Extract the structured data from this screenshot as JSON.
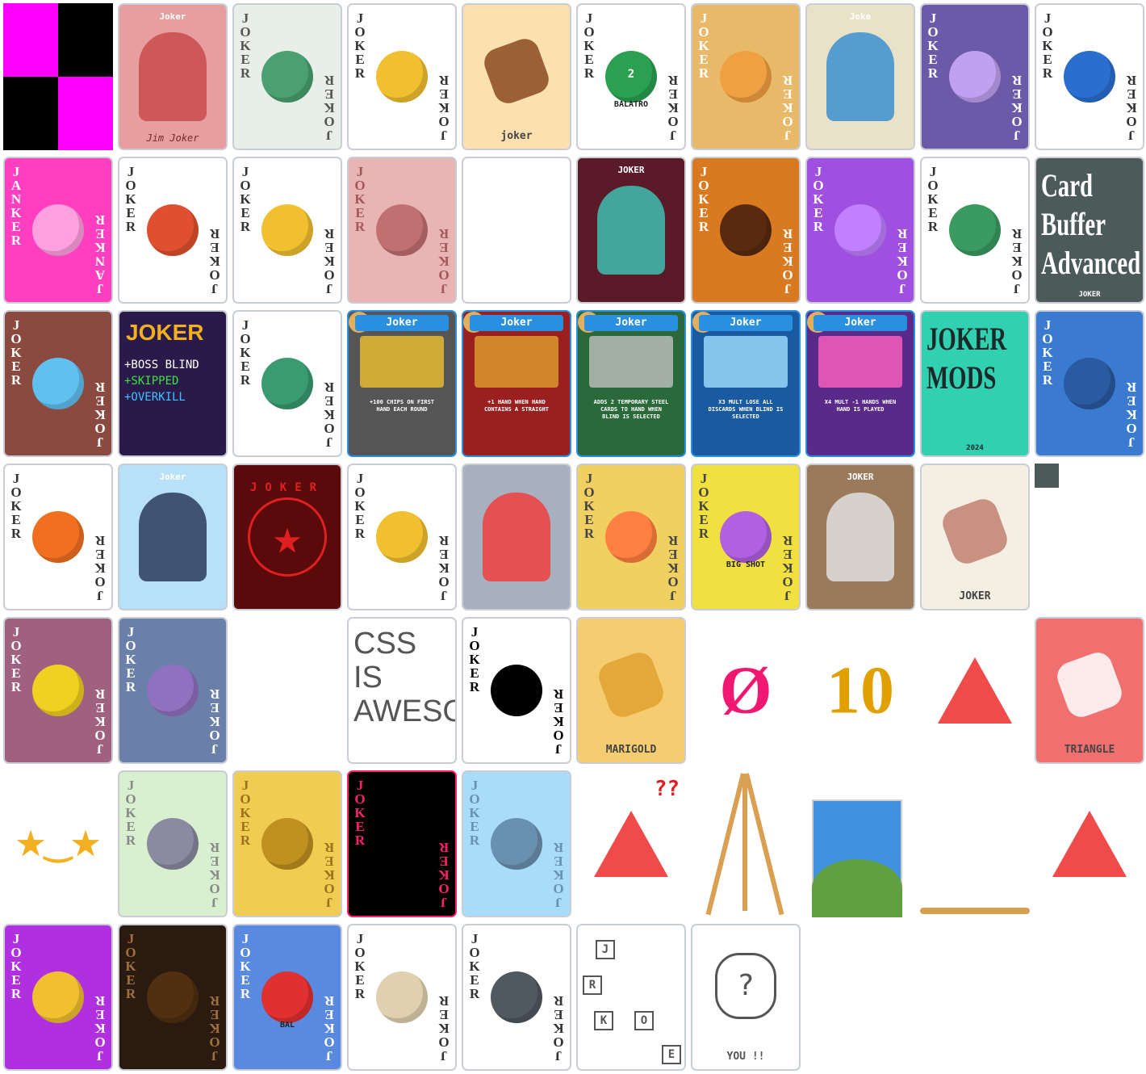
{
  "title": "",
  "tiles": [
    {
      "name": "missing-texture",
      "kind": "checker",
      "bg": "#ff00ff",
      "fg": "#000000"
    },
    {
      "name": "baseball-joker",
      "kind": "photo",
      "bg": "#e79e9e",
      "art_color": "#c94a4a",
      "caption": "Joker",
      "signature": "Jim Joker"
    },
    {
      "name": "bookshelf-joker",
      "kind": "corner",
      "corner": "JOKER",
      "bg": "#e8eee8",
      "corner_color": "#555",
      "art_color": "#4aa070"
    },
    {
      "name": "classic-joker",
      "kind": "corner",
      "corner": "JOKER",
      "bg": "#ffffff",
      "corner_color": "#333",
      "art_color": "#f0c030"
    },
    {
      "name": "pipe-joker",
      "kind": "label",
      "bg": "#fde0b0",
      "art_color": "#8a4a20",
      "label": "joker"
    },
    {
      "name": "balatro-box-joker",
      "kind": "corner",
      "corner": "JOKER",
      "bg": "#ffffff",
      "corner_color": "#333",
      "art_color": "#2aa050",
      "badge": "BALATRO",
      "num": "2"
    },
    {
      "name": "icecream-joker",
      "kind": "corner",
      "corner": "JOKER",
      "bg": "#e9b96a",
      "corner_color": "#fff",
      "art_color": "#f0a040"
    },
    {
      "name": "globe-joker",
      "kind": "photo",
      "bg": "#e9e2c8",
      "art_color": "#3b8fd0",
      "caption": "Joke"
    },
    {
      "name": "lightning-joker",
      "kind": "corner",
      "corner": "JOKER",
      "bg": "#6a5aa8",
      "corner_color": "#fff",
      "art_color": "#c0a0f0"
    },
    {
      "name": "clown-hat-joker",
      "kind": "corner",
      "corner": "JOKER",
      "bg": "#ffffff",
      "corner_color": "#333",
      "art_color": "#2a6fd0"
    },
    {
      "name": "janker-joker",
      "kind": "corner",
      "corner": "JANKER",
      "bg": "#ff3fbf",
      "corner_color": "#fff",
      "art_color": "#ffa0e0"
    },
    {
      "name": "swirl-joker",
      "kind": "corner",
      "corner": "JOKER",
      "bg": "#ffffff",
      "corner_color": "#333",
      "art_color": "#e05030"
    },
    {
      "name": "jester-joker",
      "kind": "corner",
      "corner": "JOKER",
      "bg": "#ffffff",
      "corner_color": "#333",
      "art_color": "#f0c030"
    },
    {
      "name": "sunglasses-joker",
      "kind": "corner",
      "corner": "JOKER",
      "bg": "#e8b4b4",
      "corner_color": "#a05858",
      "art_color": "#c07070"
    },
    {
      "name": "blank-card",
      "kind": "blank",
      "bg": "#ffffff"
    },
    {
      "name": "bubbles-joker",
      "kind": "photo",
      "bg": "#5a1a28",
      "art_color": "#40c0b0",
      "caption": "JOKER"
    },
    {
      "name": "coffee-joker",
      "kind": "corner",
      "corner": "JOKER",
      "bg": "#d97a20",
      "corner_color": "#fff",
      "art_color": "#5a2a10"
    },
    {
      "name": "lollipop-joker",
      "kind": "corner",
      "corner": "JOKER",
      "bg": "#a050e0",
      "corner_color": "#fff",
      "art_color": "#c080ff"
    },
    {
      "name": "clover-joker",
      "kind": "corner",
      "corner": "JOKER",
      "bg": "#ffffff",
      "corner_color": "#333",
      "art_color": "#3a9a60"
    },
    {
      "name": "card-buffer-advanced",
      "kind": "title",
      "bg": "#4d5a5a",
      "fg": "#ffffff",
      "text": "Card\nBuffer\nAdvanced",
      "subtitle": "JOKER"
    },
    {
      "name": "dice-joker",
      "kind": "corner",
      "corner": "JOKER",
      "bg": "#8a4a40",
      "corner_color": "#fff",
      "art_color": "#60c0f0"
    },
    {
      "name": "boss-blind-joker",
      "kind": "list",
      "bg": "#2a1a4a",
      "heading": "JOKER",
      "heading_color": "#f0b020",
      "lines": [
        "+BOSS BLIND",
        "+SKIPPED",
        "+OVERKILL"
      ],
      "line_colors": [
        "#ffffff",
        "#40e040",
        "#40c0ff"
      ]
    },
    {
      "name": "recycle-joker",
      "kind": "corner",
      "corner": "JOKER",
      "bg": "#ffffff",
      "corner_color": "#333",
      "art_color": "#3a9a70"
    },
    {
      "name": "gold-figure-joker",
      "kind": "framed",
      "header": "Joker",
      "bg": "#555555",
      "header_bg": "#2a8fe0",
      "art_color": "#f0c030",
      "desc": "+100 CHIPS ON FIRST HAND EACH ROUND"
    },
    {
      "name": "straight-joker",
      "kind": "framed",
      "header": "Joker",
      "bg": "#9a2020",
      "header_bg": "#2a8fe0",
      "art_color": "#e0a030",
      "desc": "+1 HAND WHEN HAND CONTAINS A STRAIGHT"
    },
    {
      "name": "steel-joker",
      "kind": "framed",
      "header": "Joker",
      "bg": "#2a6a3a",
      "header_bg": "#2a8fe0",
      "art_color": "#c0c0c0",
      "desc": "ADDS 2 TEMPORARY STEEL CARDS TO HAND WHEN BLIND IS SELECTED"
    },
    {
      "name": "ice-joker",
      "kind": "framed",
      "header": "Joker",
      "bg": "#1a5aa0",
      "header_bg": "#2a8fe0",
      "art_color": "#a0e0ff",
      "desc": "X3 MULT LOSE ALL DISCARDS WHEN BLIND IS SELECTED"
    },
    {
      "name": "mult-joker",
      "kind": "framed",
      "header": "Joker",
      "bg": "#5a2a8a",
      "header_bg": "#2a8fe0",
      "art_color": "#ff60c0",
      "desc": "X4 MULT -1 HANDS WHEN HAND IS PLAYED"
    },
    {
      "name": "joker-mods",
      "kind": "title",
      "bg": "#30d0b0",
      "fg": "#1a2a2a",
      "text": "JOKER\nMODS",
      "subtitle": "2024"
    },
    {
      "name": "bowling-joker",
      "kind": "corner",
      "corner": "JOKER",
      "bg": "#3a7ad0",
      "corner_color": "#fff",
      "art_color": "#2a5aa0"
    },
    {
      "name": "clownfish-joker",
      "kind": "corner",
      "corner": "JOKER",
      "bg": "#ffffff",
      "corner_color": "#333",
      "art_color": "#f07020"
    },
    {
      "name": "magician-joker",
      "kind": "photo",
      "bg": "#b8e0f8",
      "art_color": "#2a3a5a",
      "caption": "Joker"
    },
    {
      "name": "pentagram-joker",
      "kind": "letters",
      "bg": "#5a0a0a",
      "art_color": "#e02020",
      "letters": "JOKER"
    },
    {
      "name": "classic-joker-2",
      "kind": "corner",
      "corner": "JOKER",
      "bg": "#ffffff",
      "corner_color": "#333",
      "art_color": "#f0c030"
    },
    {
      "name": "peek-joker",
      "kind": "photo",
      "bg": "#a8b0c0",
      "art_color": "#f04040",
      "caption": ""
    },
    {
      "name": "rainbow-joker",
      "kind": "corner",
      "corner": "JOKER",
      "bg": "#f0d060",
      "corner_color": "#444",
      "art_color": "#ff8040"
    },
    {
      "name": "big-shot-joker",
      "kind": "corner",
      "corner": "JOKER",
      "bg": "#f0e040",
      "corner_color": "#444",
      "art_color": "#b060e0",
      "badge": "BIG SHOT"
    },
    {
      "name": "ghost-joker",
      "kind": "photo",
      "bg": "#9a7a5a",
      "art_color": "#e0e0e0",
      "caption": "JOKER"
    },
    {
      "name": "map-joker",
      "kind": "label",
      "bg": "#f4efe2",
      "art_color": "#c08070",
      "label": "JOKER"
    },
    {
      "name": "small-square",
      "kind": "square",
      "bg": "#4d5a5a"
    },
    {
      "name": "macaron-joker",
      "kind": "corner",
      "corner": "JOKER",
      "bg": "#a06080",
      "corner_color": "#fff",
      "art_color": "#f0d020"
    },
    {
      "name": "grid-joker",
      "kind": "corner",
      "corner": "JOKER",
      "bg": "#6a80a8",
      "corner_color": "#fff",
      "art_color": "#9070c0"
    },
    {
      "name": "blank-2",
      "kind": "empty"
    },
    {
      "name": "css-is-awesome",
      "kind": "title",
      "bg": "#ffffff",
      "fg": "#555555",
      "text": "CSS\nIS\nAWESOME",
      "subtitle": ""
    },
    {
      "name": "bw-joker",
      "kind": "corner",
      "corner": "JOKER",
      "bg": "#ffffff",
      "corner_color": "#000",
      "art_color": "#000000"
    },
    {
      "name": "marigold",
      "kind": "label",
      "bg": "#f6cc70",
      "art_color": "#e0a030",
      "label": "MARIGOLD"
    },
    {
      "name": "null-symbol",
      "kind": "symbol",
      "glyph": "Ø",
      "color": "#f01870"
    },
    {
      "name": "ten",
      "kind": "symbol",
      "glyph": "10",
      "color": "#e0a000"
    },
    {
      "name": "triangle-face",
      "kind": "triangle",
      "color": "#f04a4a"
    },
    {
      "name": "triangle-card",
      "kind": "label",
      "bg": "#f07070",
      "art_color": "#ffffff",
      "label": "TRIANGLE"
    },
    {
      "name": "star-eyes",
      "kind": "symbol",
      "glyph": "★‿★",
      "color": "#f0b020"
    },
    {
      "name": "rat-joker",
      "kind": "corner",
      "corner": "JOKER",
      "bg": "#d8f0d0",
      "corner_color": "#888",
      "art_color": "#8a8aa0"
    },
    {
      "name": "gold-joker",
      "kind": "corner",
      "corner": "JOKER",
      "bg": "#f0cc50",
      "corner_color": "#9a7020",
      "art_color": "#c09020"
    },
    {
      "name": "black-joker",
      "kind": "corner",
      "corner": "JOKER",
      "bg": "#000000",
      "corner_color": "#ff2070",
      "art_color": "#000000",
      "border_color": "#ff2070"
    },
    {
      "name": "ice-joker-2",
      "kind": "corner",
      "corner": "JOKER",
      "bg": "#a8dcf8",
      "corner_color": "#6a90b0",
      "art_color": "#6a90b0"
    },
    {
      "name": "triangle-confused",
      "kind": "triangle",
      "color": "#f04a4a",
      "extra": "??"
    },
    {
      "name": "easel",
      "kind": "easel",
      "color": "#d8a050"
    },
    {
      "name": "landscape",
      "kind": "landscape",
      "bg": "#4090e0",
      "art_color": "#60a040"
    },
    {
      "name": "bar",
      "kind": "hbar",
      "color": "#d8a050"
    },
    {
      "name": "triangle-smile",
      "kind": "triangle",
      "color": "#f04a4a"
    },
    {
      "name": "purple-joker",
      "kind": "corner",
      "corner": "JOKER",
      "bg": "#b030e0",
      "corner_color": "#fff",
      "art_color": "#f0c030"
    },
    {
      "name": "dark-joker",
      "kind": "corner",
      "corner": "JOKER",
      "bg": "#2a1a10",
      "corner_color": "#a07040",
      "art_color": "#503010"
    },
    {
      "name": "mailbox-joker",
      "kind": "corner",
      "corner": "JOKER",
      "bg": "#5a8ae0",
      "corner_color": "#fff",
      "art_color": "#e03030",
      "badge": "BAL"
    },
    {
      "name": "mini-card-joker",
      "kind": "corner",
      "corner": "JOKER",
      "bg": "#ffffff",
      "corner_color": "#333",
      "art_color": "#e0d0b0"
    },
    {
      "name": "spot-joker",
      "kind": "corner",
      "corner": "JOKER",
      "bg": "#ffffff",
      "corner_color": "#333",
      "art_color": "#505860"
    },
    {
      "name": "maze-joker",
      "kind": "maze",
      "bg": "#ffffff",
      "art_color": "#555555",
      "letters": [
        "J",
        "R",
        "K",
        "O",
        "E"
      ]
    },
    {
      "name": "you-card",
      "kind": "label",
      "bg": "#ffffff",
      "art_color": "#555555",
      "label": "YOU !!",
      "glyph": "?"
    }
  ]
}
